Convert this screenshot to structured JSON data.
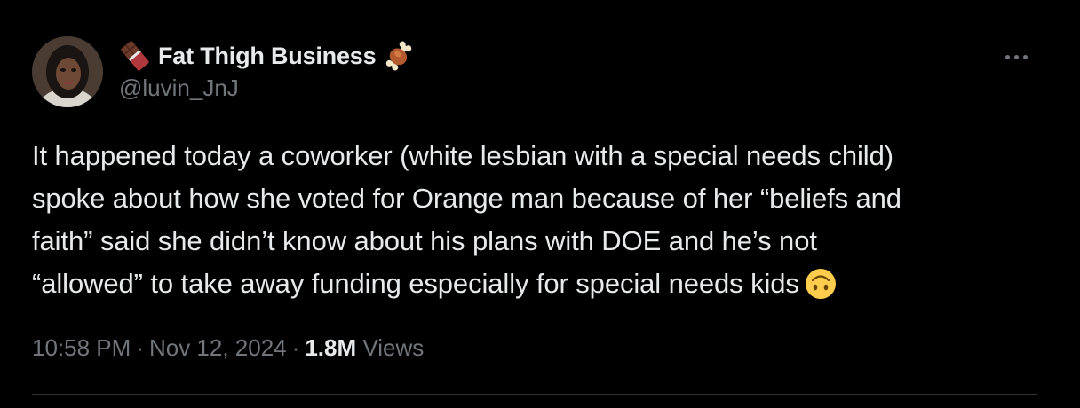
{
  "author": {
    "name_emoji_left": "chocolate-bar-emoji",
    "display_name": "Fat Thigh Business",
    "name_emoji_right": "meat-on-bone-emoji",
    "handle": "@luvin_JnJ"
  },
  "tweet": {
    "lines": [
      "It happened today a coworker (white lesbian with a special needs child)",
      "spoke about how she voted for Orange man because of her “beliefs and",
      "faith” said she didn’t know about his plans with DOE and he’s not",
      "“allowed” to take away funding especially for special needs kids"
    ],
    "trailing_emoji": "upside-down-face-emoji"
  },
  "meta": {
    "time": "10:58 PM",
    "separator": "·",
    "date": "Nov 12, 2024",
    "views_count": "1.8M",
    "views_label": "Views"
  },
  "colors": {
    "background": "#000000",
    "text": "#e7e9ea",
    "secondary": "#71767b",
    "divider": "#2f3336"
  }
}
